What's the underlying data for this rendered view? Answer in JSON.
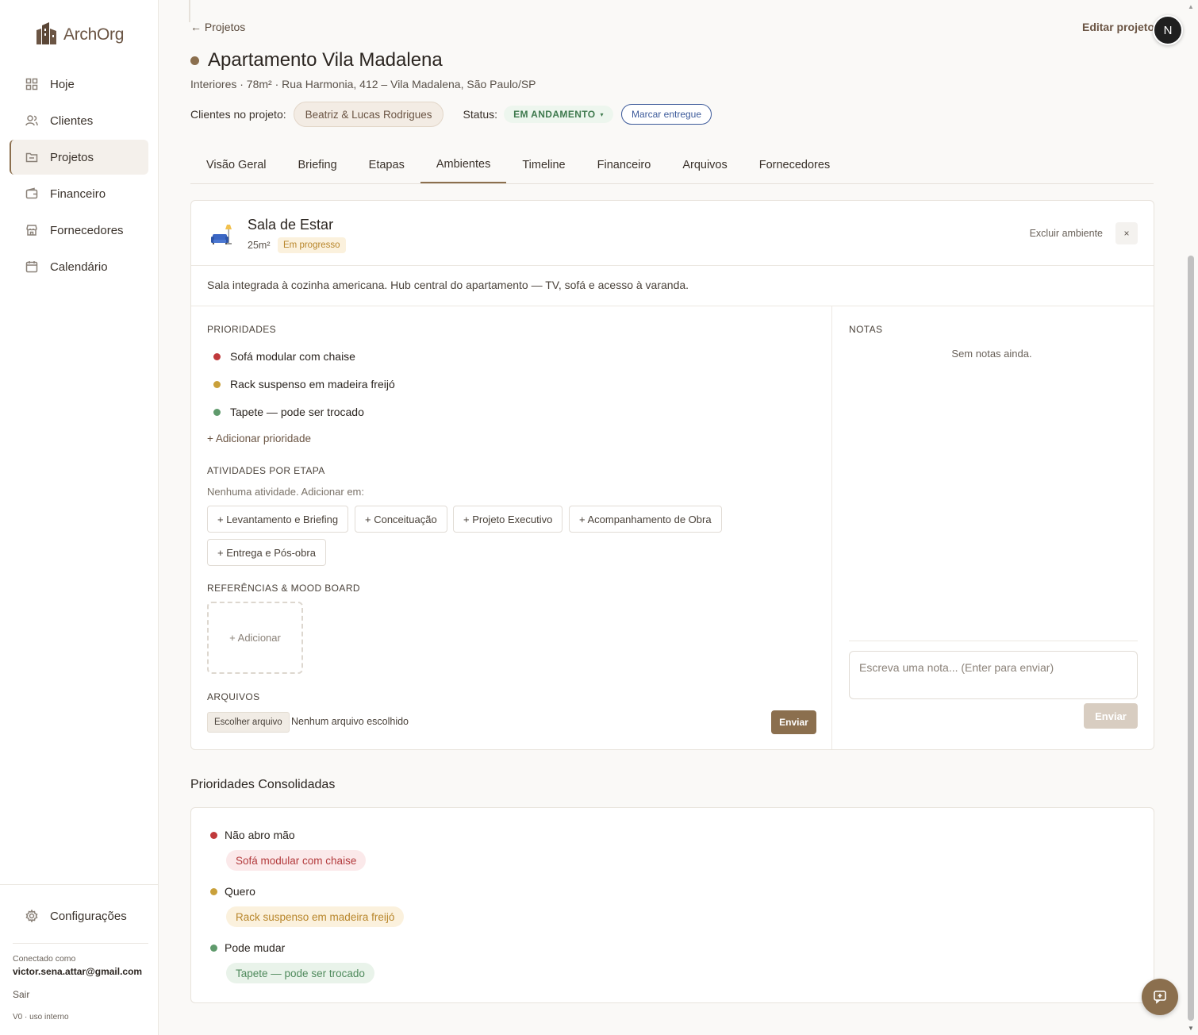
{
  "brand": {
    "name": "ArchOrg"
  },
  "sidebar": {
    "items": [
      {
        "label": "Hoje",
        "icon": "grid-icon"
      },
      {
        "label": "Clientes",
        "icon": "users-icon"
      },
      {
        "label": "Projetos",
        "icon": "folder-icon",
        "active": true
      },
      {
        "label": "Financeiro",
        "icon": "wallet-icon"
      },
      {
        "label": "Fornecedores",
        "icon": "store-icon"
      },
      {
        "label": "Calendário",
        "icon": "calendar-icon"
      }
    ],
    "settings_label": "Configurações",
    "connected_label": "Conectado como",
    "user_email": "victor.sena.attar@gmail.com",
    "logout_label": "Sair",
    "version_label": "V0 · uso interno"
  },
  "header": {
    "back_label": "← Projetos",
    "edit_label": "Editar projeto",
    "avatar_initial": "N",
    "title": "Apartamento Vila Madalena",
    "subtitle": "Interiores · 78m² · Rua Harmonia, 412 – Vila Madalena, São Paulo/SP",
    "clients_label": "Clientes no projeto:",
    "clients_value": "Beatriz & Lucas Rodrigues",
    "status_label": "Status:",
    "status_value": "EM ANDAMENTO",
    "mark_delivered_label": "Marcar entregue"
  },
  "tabs": [
    {
      "label": "Visão Geral"
    },
    {
      "label": "Briefing"
    },
    {
      "label": "Etapas"
    },
    {
      "label": "Ambientes",
      "active": true
    },
    {
      "label": "Timeline"
    },
    {
      "label": "Financeiro"
    },
    {
      "label": "Arquivos"
    },
    {
      "label": "Fornecedores"
    }
  ],
  "room": {
    "name": "Sala de Estar",
    "area": "25m²",
    "status": "Em progresso",
    "delete_label": "Excluir ambiente",
    "close_label": "×",
    "description": "Sala integrada à cozinha americana. Hub central do apartamento — TV, sofá e acesso à varanda.",
    "priorities_label": "PRIORIDADES",
    "priorities": [
      {
        "text": "Sofá modular com chaise",
        "color": "#c0393b"
      },
      {
        "text": "Rack suspenso em madeira freijó",
        "color": "#c9a03a"
      },
      {
        "text": "Tapete — pode ser trocado",
        "color": "#5f9a6c"
      }
    ],
    "add_priority_label": "+ Adicionar prioridade",
    "activities_label": "ATIVIDADES POR ETAPA",
    "no_activity_label": "Nenhuma atividade. Adicionar em:",
    "stages": [
      "+ Levantamento e Briefing",
      "+ Conceituação",
      "+ Projeto Executivo",
      "+ Acompanhamento de Obra",
      "+ Entrega e Pós-obra"
    ],
    "moodboard_label": "REFERÊNCIAS & MOOD BOARD",
    "moodboard_add_label": "+ Adicionar",
    "files_label": "ARQUIVOS",
    "choose_file_label": "Escolher arquivo",
    "no_file_label": "Nenhum arquivo escolhido",
    "send_file_label": "Enviar",
    "notes_label": "NOTAS",
    "no_notes_label": "Sem notas ainda.",
    "note_placeholder": "Escreva uma nota... (Enter para enviar)",
    "send_note_label": "Enviar"
  },
  "consolidated": {
    "title": "Prioridades Consolidadas",
    "groups": [
      {
        "label": "Não abro mão",
        "item": "Sofá modular com chaise",
        "color": "#c0393b"
      },
      {
        "label": "Quero",
        "item": "Rack suspenso em madeira freijó",
        "color": "#c9a03a"
      },
      {
        "label": "Pode mudar",
        "item": "Tapete — pode ser trocado",
        "color": "#5f9a6c"
      }
    ]
  },
  "colors": {
    "accent": "#8b6f4e",
    "status_green": "#3f7a4e",
    "link_blue": "#3c5a9a"
  }
}
